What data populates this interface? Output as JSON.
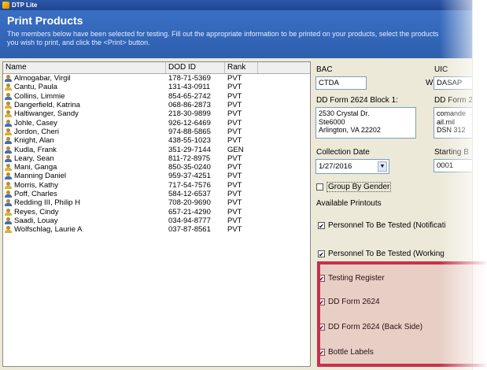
{
  "window": {
    "title": "DTP Lite"
  },
  "banner": {
    "title": "Print Products",
    "description": "The members below have been selected for testing.  Fill out the appropriate information to be printed on your products, select the products you wish to print, and click the <Print> button."
  },
  "list": {
    "columns": [
      "Name",
      "DOD ID",
      "Rank"
    ],
    "rows": [
      {
        "name": "Almogabar, Virgil",
        "dod": "178-71-5369",
        "rank": "PVT",
        "icon": "male-user-icon"
      },
      {
        "name": "Cantu, Paula",
        "dod": "131-43-0911",
        "rank": "PVT",
        "icon": "female-user-icon"
      },
      {
        "name": "Collins, Limmie",
        "dod": "854-65-2742",
        "rank": "PVT",
        "icon": "male-user-icon"
      },
      {
        "name": "Dangerfield, Katrina",
        "dod": "068-86-2873",
        "rank": "PVT",
        "icon": "female-user-icon"
      },
      {
        "name": "Haltiwanger, Sandy",
        "dod": "218-30-9899",
        "rank": "PVT",
        "icon": "female-user-icon"
      },
      {
        "name": "Johle, Casey",
        "dod": "926-12-6469",
        "rank": "PVT",
        "icon": "male-user-icon"
      },
      {
        "name": "Jordon, Cheri",
        "dod": "974-88-5865",
        "rank": "PVT",
        "icon": "female-user-icon"
      },
      {
        "name": "Knight, Alan",
        "dod": "438-55-1023",
        "rank": "PVT",
        "icon": "male-user-icon"
      },
      {
        "name": "Kudla, Frank",
        "dod": "351-29-7144",
        "rank": "GEN",
        "icon": "male-user-icon"
      },
      {
        "name": "Leary, Sean",
        "dod": "811-72-8975",
        "rank": "PVT",
        "icon": "male-user-icon"
      },
      {
        "name": "Mani, Ganga",
        "dod": "850-35-0240",
        "rank": "PVT",
        "icon": "female-user-icon"
      },
      {
        "name": "Manning Daniel",
        "dod": "959-37-4251",
        "rank": "PVT",
        "icon": "male-user-icon"
      },
      {
        "name": "Morris, Kathy",
        "dod": "717-54-7576",
        "rank": "PVT",
        "icon": "female-user-icon"
      },
      {
        "name": "Poff, Charles",
        "dod": "584-12-6537",
        "rank": "PVT",
        "icon": "male-user-icon"
      },
      {
        "name": "Redding III, Philip H",
        "dod": "708-20-9690",
        "rank": "PVT",
        "icon": "male-user-icon"
      },
      {
        "name": "Reyes, Cindy",
        "dod": "657-21-4290",
        "rank": "PVT",
        "icon": "female-user-icon"
      },
      {
        "name": "Saadi, Louay",
        "dod": "034-94-8777",
        "rank": "PVT",
        "icon": "male-user-icon"
      },
      {
        "name": "Wolfschlag, Laurie A",
        "dod": "037-87-8561",
        "rank": "PVT",
        "icon": "female-user-icon"
      }
    ]
  },
  "form": {
    "bac_label": "BAC",
    "bac_value": "CTDA",
    "uic_label": "UIC",
    "uic_prefix": "W",
    "uic_value": "DASAP",
    "block1_label": "DD Form 2624 Block 1:",
    "block1_value": "2530 Crystal Dr.\nSte6000\nArlington, VA 22202",
    "block2_label": "DD Form 2",
    "block2_value": "comande\nail.mil\nDSN 312",
    "collection_label": "Collection Date",
    "collection_value": "1/27/2016",
    "starting_label": "Starting B",
    "starting_value": "0001",
    "group_by_gender": "Group By Gender",
    "available_printouts": "Available Printouts"
  },
  "printouts": [
    {
      "label": "Personnel To Be Tested (Notificati",
      "checked": true
    },
    {
      "label": "Personnel To Be Tested (Working",
      "checked": true
    },
    {
      "label": "Testing Register",
      "checked": true
    },
    {
      "label": "DD Form 2624",
      "checked": true
    },
    {
      "label": "DD Form 2624 (Back Side)",
      "checked": true
    },
    {
      "label": "Bottle Labels",
      "checked": true
    }
  ],
  "colors": {
    "highlight": "#c9304d",
    "banner": "#3a6fc4"
  }
}
